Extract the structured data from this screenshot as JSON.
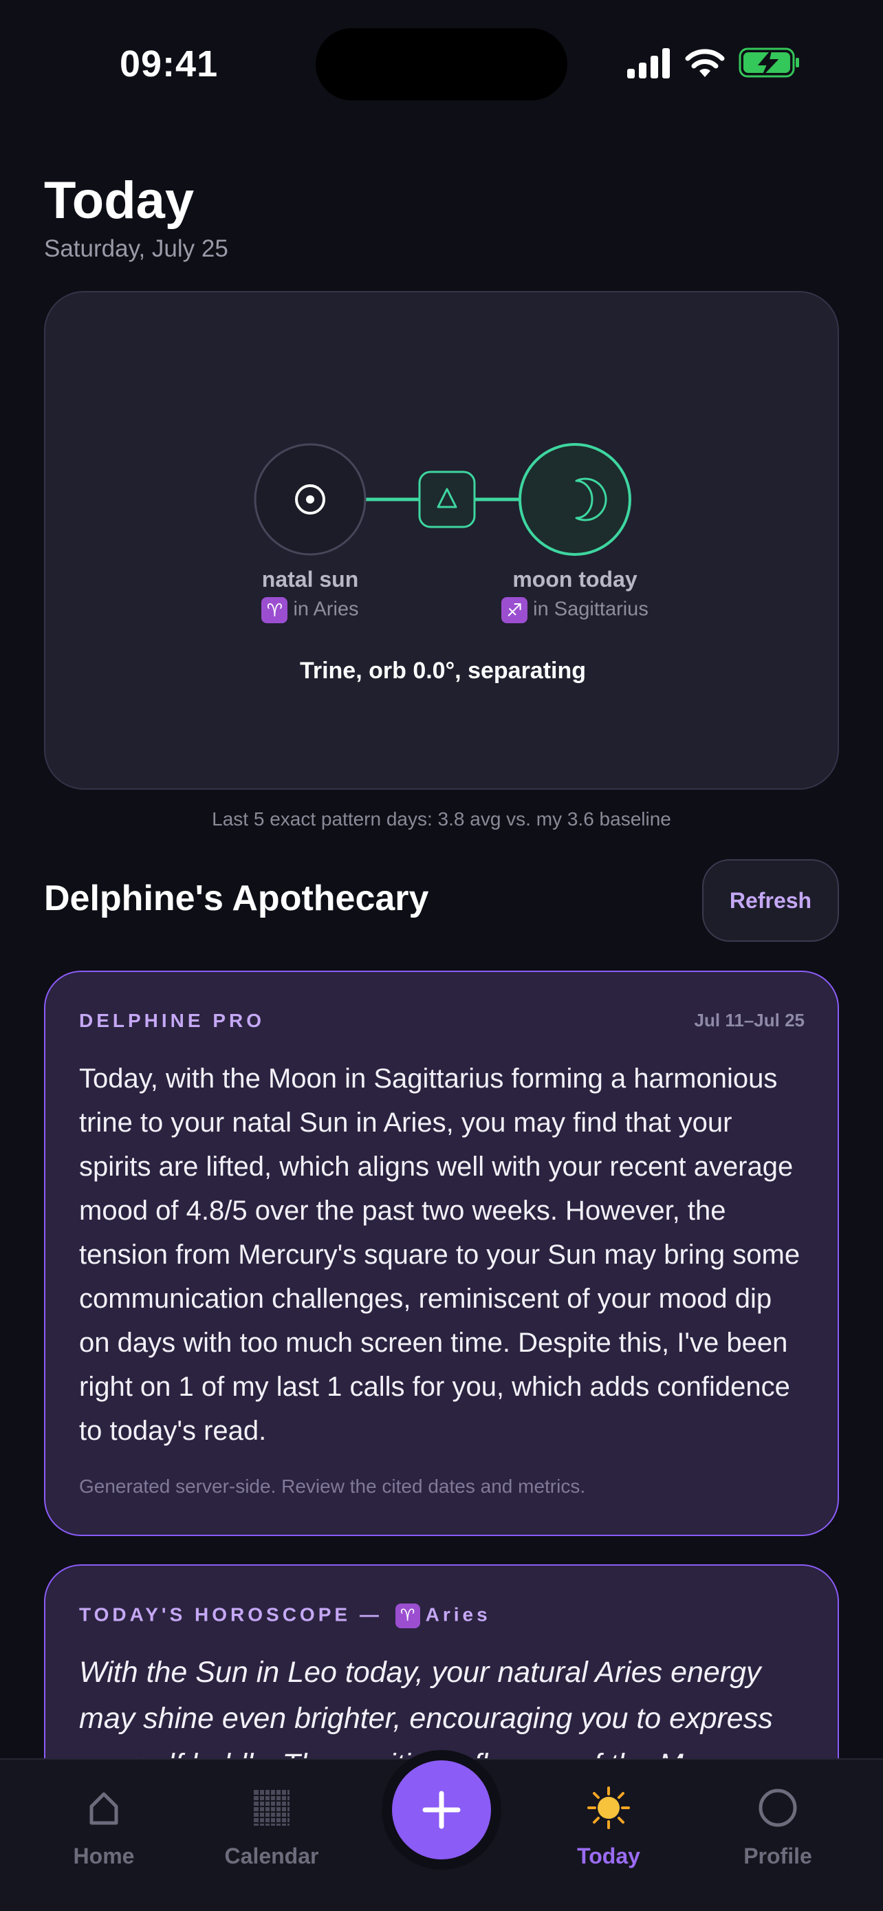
{
  "status_bar": {
    "time": "09:41"
  },
  "header": {
    "title": "Today",
    "date": "Saturday, July 25"
  },
  "aspect": {
    "left_label": "natal sun",
    "left_sign_glyph": "♈",
    "left_sign_text": "in Aries",
    "right_label": "moon today",
    "right_sign_glyph": "♐",
    "right_sign_text": "in Sagittarius",
    "summary": "Trine, orb 0.0°, separating",
    "accent": "#3ed6a0"
  },
  "baseline_text": "Last 5 exact pattern days: 3.8 avg vs. my 3.6 baseline",
  "section": {
    "title": "Delphine's Apothecary",
    "refresh_label": "Refresh"
  },
  "pro_card": {
    "label": "DELPHINE PRO",
    "range": "Jul 11–Jul 25",
    "body": "Today, with the Moon in Sagittarius forming a harmonious trine to your natal Sun in Aries, you may find that your spirits are lifted, which aligns well with your recent average mood of 4.8/5 over the past two weeks. However, the tension from Mercury's square to your Sun may bring some communication challenges, reminiscent of your mood dip on days with too much screen time. Despite this, I've been right on 1 of my last 1 calls for you, which adds confidence to today's read.",
    "footnote": "Generated server-side. Review the cited dates and metrics."
  },
  "horoscope_card": {
    "label_prefix": "TODAY'S HOROSCOPE —",
    "sign_glyph": "♈",
    "sign_name": "Aries",
    "body": "With the Sun in Leo today, your natural Aries energy may shine even brighter, encouraging you to express yourself boldly. The positive influence of the Moon"
  },
  "tabs": [
    {
      "label": "Home",
      "icon": "home-icon",
      "active": false
    },
    {
      "label": "Calendar",
      "icon": "calendar-icon",
      "active": false
    },
    {
      "label": "Today",
      "icon": "sun-icon",
      "active": true
    },
    {
      "label": "Profile",
      "icon": "profile-icon",
      "active": false
    }
  ],
  "colors": {
    "accent_purple": "#8b5cf6",
    "accent_green": "#3ed6a0",
    "background": "#0e0e16"
  }
}
